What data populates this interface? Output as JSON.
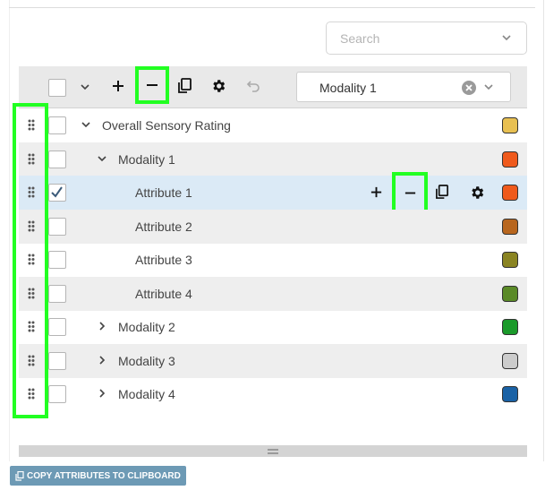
{
  "search": {
    "placeholder": "Search"
  },
  "toolbar": {
    "filter_value": "Modality 1",
    "buttons": [
      "plus-icon",
      "minus-icon",
      "copy-icon",
      "gear-icon",
      "undo-icon"
    ]
  },
  "tree": {
    "rows": [
      {
        "label": "Overall Sensory Rating",
        "level": 0,
        "expanded": true,
        "checked": false,
        "color": "#e8c052"
      },
      {
        "label": "Modality 1",
        "level": 1,
        "expanded": true,
        "checked": false,
        "color": "#ef5a1c"
      },
      {
        "label": "Attribute 1",
        "level": 2,
        "checked": true,
        "selected": true,
        "color": "#ef5a1c"
      },
      {
        "label": "Attribute 2",
        "level": 2,
        "checked": false,
        "color": "#b8661e"
      },
      {
        "label": "Attribute 3",
        "level": 2,
        "checked": false,
        "color": "#8a8422"
      },
      {
        "label": "Attribute 4",
        "level": 2,
        "checked": false,
        "color": "#5a8a27"
      },
      {
        "label": "Modality 2",
        "level": 1,
        "expanded": false,
        "checked": false,
        "color": "#1a9a2a"
      },
      {
        "label": "Modality 3",
        "level": 1,
        "expanded": false,
        "checked": false,
        "color": "#cccccc"
      },
      {
        "label": "Modality 4",
        "level": 1,
        "expanded": false,
        "checked": false,
        "color": "#1a62a6"
      }
    ]
  },
  "footer": {
    "copy_label": "COPY ATTRIBUTES TO CLIPBOARD"
  }
}
